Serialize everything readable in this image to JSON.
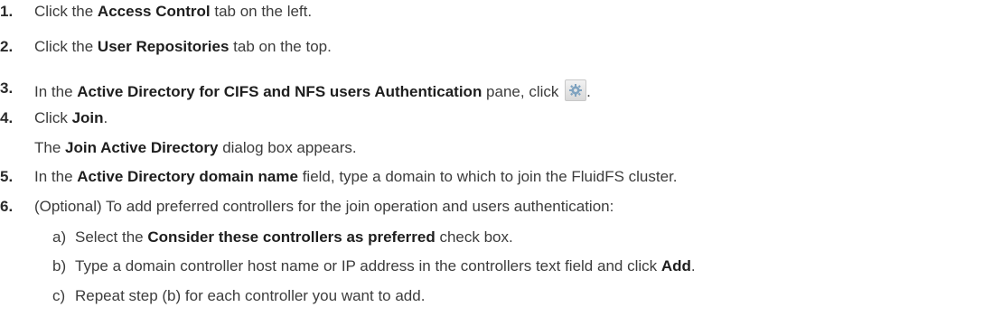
{
  "steps": [
    {
      "num": "1.",
      "pre": "Click the ",
      "bold": "Access Control",
      "post": " tab on the left."
    },
    {
      "num": "2.",
      "pre": "Click the ",
      "bold": "User Repositories",
      "post": " tab on the top."
    },
    {
      "num": "3.",
      "pre": "In the ",
      "bold": "Active Directory for CIFS and NFS users Authentication",
      "post": " pane, click ",
      "post2": "."
    },
    {
      "num": "4.",
      "pre": "Click ",
      "bold": "Join",
      "post": "."
    },
    {
      "note_pre": "The ",
      "note_bold": "Join Active Directory",
      "note_post": " dialog box appears."
    },
    {
      "num": "5.",
      "pre": "In the ",
      "bold": "Active Directory domain name",
      "post": " field, type a domain to which to join the FluidFS cluster."
    },
    {
      "num": "6.",
      "pre": "(Optional) To add preferred controllers for the join operation and users authentication:"
    }
  ],
  "substeps": [
    {
      "letter": "a)",
      "pre": "Select the ",
      "bold": "Consider these controllers as preferred",
      "post": " check box."
    },
    {
      "letter": "b)",
      "pre": "Type a domain controller host name or IP address in the controllers text field and click ",
      "bold": "Add",
      "post": "."
    },
    {
      "letter": "c)",
      "pre": "Repeat step (b) for each controller you want to add.",
      "bold": "",
      "post": ""
    }
  ],
  "icons": {
    "settings": "gear-icon"
  }
}
